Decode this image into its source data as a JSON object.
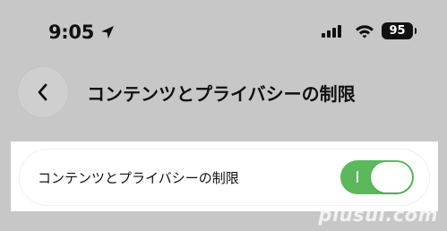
{
  "status_bar": {
    "time": "9:05",
    "battery": "95",
    "icons": [
      "location-arrow-icon",
      "cellular-signal-icon",
      "wifi-icon",
      "battery-icon"
    ]
  },
  "header": {
    "title": "コンテンツとプライバシーの制限",
    "back_icon": "chevron-left-icon"
  },
  "settings": {
    "row_label": "コンテンツとプライバシーの制限",
    "toggle_state": "on",
    "toggle_color": "#5bb85b"
  },
  "watermark": "plusul.com"
}
